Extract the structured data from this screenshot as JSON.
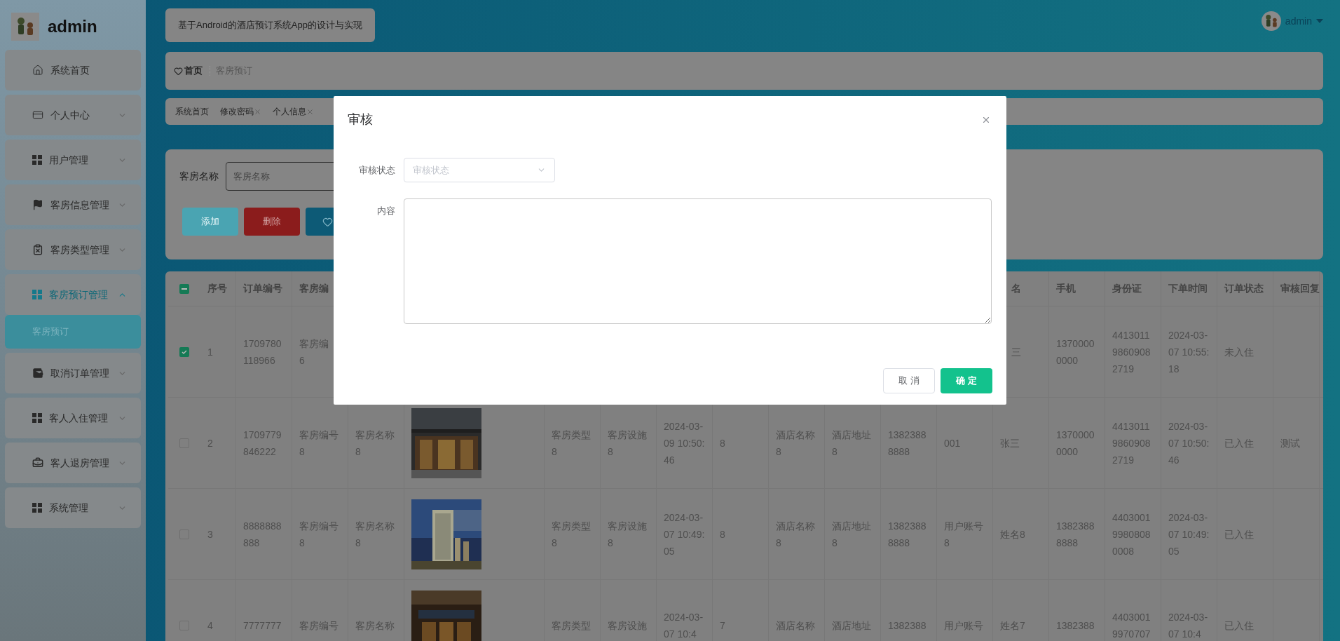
{
  "sidebar": {
    "title": "admin",
    "items": [
      {
        "label": "系统首页",
        "kind": "link",
        "selected": false
      },
      {
        "label": "个人中心",
        "kind": "menu",
        "selected": false,
        "expanded": false
      },
      {
        "label": "用户管理",
        "kind": "menu",
        "selected": false,
        "expanded": false
      },
      {
        "label": "客房信息管理",
        "kind": "menu",
        "selected": false,
        "expanded": false
      },
      {
        "label": "客房类型管理",
        "kind": "menu",
        "selected": false,
        "expanded": false
      },
      {
        "label": "客房预订管理",
        "kind": "menu",
        "selected": true,
        "expanded": true,
        "children": [
          {
            "label": "客房预订",
            "selected": true
          }
        ]
      },
      {
        "label": "取消订单管理",
        "kind": "menu",
        "selected": false,
        "expanded": false
      },
      {
        "label": "客人入住管理",
        "kind": "menu",
        "selected": false,
        "expanded": false
      },
      {
        "label": "客人退房管理",
        "kind": "menu",
        "selected": false,
        "expanded": false
      },
      {
        "label": "系统管理",
        "kind": "menu",
        "selected": false,
        "expanded": false
      }
    ]
  },
  "header": {
    "system_title": "基于Android的酒店预订系统App的设计与实现",
    "user": "admin"
  },
  "breadcrumb": [
    {
      "label": "首页",
      "kind": "home"
    },
    {
      "label": "客房预订",
      "kind": "current"
    }
  ],
  "tabs": [
    {
      "label": "系统首页",
      "closable": false
    },
    {
      "label": "修改密码",
      "closable": true
    },
    {
      "label": "个人信息",
      "closable": true
    }
  ],
  "search": {
    "label": "客房名称",
    "placeholder": "客房名称"
  },
  "buttons": [
    {
      "kind": "add",
      "label": "添加"
    },
    {
      "kind": "delete",
      "label": "删除"
    },
    {
      "kind": "favorite"
    }
  ],
  "table": {
    "select_all": {
      "indeterminate": true
    },
    "columns": [
      {
        "label": "序号"
      },
      {
        "label": "订单编号"
      },
      {
        "label": "客房编"
      },
      null,
      null,
      null,
      null,
      null,
      null,
      null,
      null,
      null,
      null,
      {
        "label": "名"
      },
      {
        "label": "手机"
      },
      {
        "label": "身份证"
      },
      {
        "label": "下单时间"
      },
      {
        "label": "订单状态"
      },
      {
        "label": "审核回复"
      }
    ],
    "rows": [
      {
        "selected": true,
        "cells": [
          "1",
          "1709780118966",
          "客房编\n6",
          null,
          null,
          null,
          null,
          null,
          null,
          null,
          null,
          null,
          null,
          "三",
          "13700000000",
          "441301198609082719",
          "2024-03-07 10:55:18",
          "未入住",
          null
        ]
      },
      {
        "selected": false,
        "cells": [
          "2",
          "1709779846222",
          "客房编号8",
          "客房名称8",
          {
            "kind": "picture"
          },
          "客房类型8",
          "客房设施8",
          "2024-03-09 10:50:46",
          "8",
          "酒店名称8",
          "酒店地址8",
          "13823888888",
          "001",
          "张三",
          "13700000000",
          "441301198609082719",
          "2024-03-07 10:50:46",
          "已入住",
          "测试"
        ]
      },
      {
        "selected": false,
        "cells": [
          "3",
          "8888888888",
          "客房编号8",
          "客房名称8",
          {
            "kind": "picture"
          },
          "客房类型8",
          "客房设施8",
          "2024-03-07 10:49:05",
          "8",
          "酒店名称8",
          "酒店地址8",
          "13823888888",
          "用户账号8",
          "姓名8",
          "13823888888",
          "440300199808080008",
          "2024-03-07 10:49:05",
          "已入住",
          null
        ]
      },
      {
        "selected": false,
        "cells": [
          "4",
          "7777777",
          "客房编号",
          "客房名称",
          {
            "kind": "picture"
          },
          "客房类型",
          "客房设施",
          "2024-03-07 10:4",
          "7",
          "酒店名称",
          "酒店地址",
          "1382388",
          "用户账号",
          "姓名7",
          "1382388",
          "44030019970707",
          "2024-03-07 10:4",
          "已入住",
          null
        ]
      }
    ]
  },
  "dialog": {
    "title": "审核",
    "fields": [
      {
        "kind": "select",
        "label": "审核状态",
        "placeholder": "审核状态"
      },
      {
        "kind": "textarea",
        "label": "内容"
      }
    ],
    "buttons": [
      {
        "kind": "cancel",
        "label": "取 消"
      },
      {
        "kind": "confirm",
        "label": "确 定"
      }
    ]
  }
}
